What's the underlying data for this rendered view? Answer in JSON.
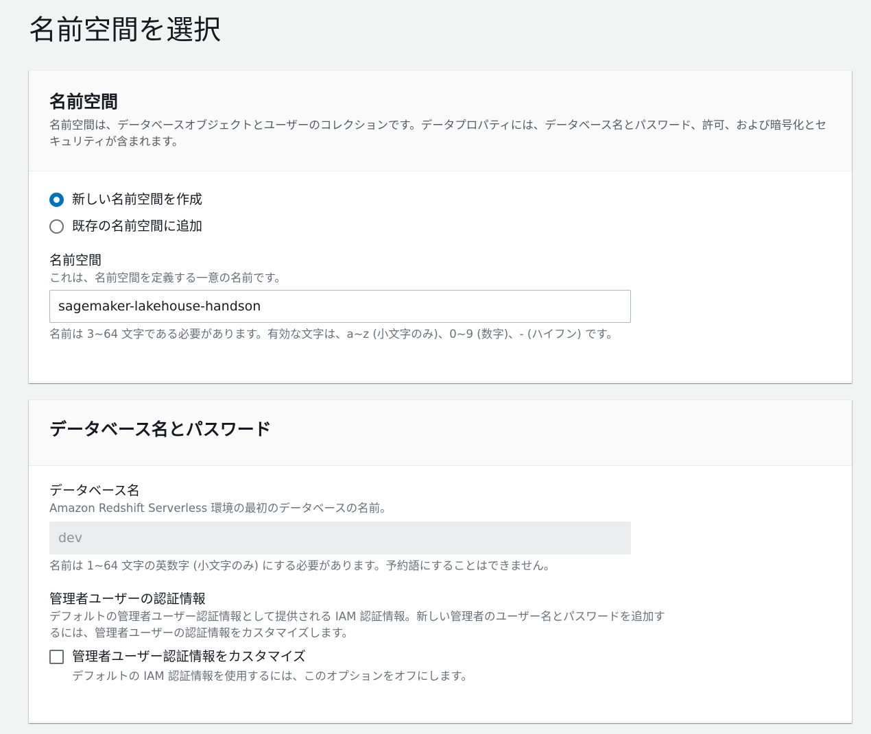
{
  "page": {
    "title": "名前空間を選択"
  },
  "namespace_section": {
    "title": "名前空間",
    "description": "名前空間は、データベースオブジェクトとユーザーのコレクションです。データプロパティには、データベース名とパスワード、許可、および暗号化とセキュリティが含まれます。",
    "options": [
      {
        "label": "新しい名前空間を作成",
        "selected": true
      },
      {
        "label": "既存の名前空間に追加",
        "selected": false
      }
    ],
    "field_label": "名前空間",
    "field_description": "これは、名前空間を定義する一意の名前です。",
    "input_value": "sagemaker-lakehouse-handson",
    "constraint": "名前は 3~64 文字である必要があります。有効な文字は、a~z (小文字のみ)、0~9 (数字)、- (ハイフン) です。"
  },
  "database_section": {
    "title": "データベース名とパスワード",
    "db_label": "データベース名",
    "db_description": "Amazon Redshift Serverless 環境の最初のデータベースの名前。",
    "db_value": "dev",
    "db_constraint": "名前は 1~64 文字の英数字 (小文字のみ) にする必要があります。予約語にすることはできません。",
    "admin_label": "管理者ユーザーの認証情報",
    "admin_description": "デフォルトの管理者ユーザー認証情報として提供される IAM 認証情報。新しい管理者のユーザー名とパスワードを追加するには、管理者ユーザーの認証情報をカスタマイズします。",
    "customize_label": "管理者ユーザー認証情報をカスタマイズ",
    "customize_description": "デフォルトの IAM 認証情報を使用するには、このオプションをオフにします。",
    "customize_checked": false
  },
  "colors": {
    "accent": "#0073bb",
    "text": "#16191f",
    "secondary_text": "#687078",
    "page_bg": "#f2f3f3"
  }
}
